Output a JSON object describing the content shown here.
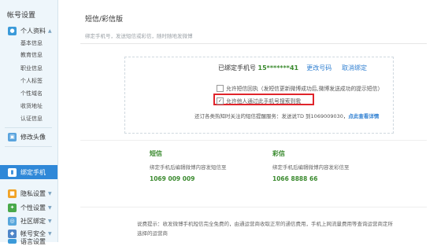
{
  "sidebar": {
    "title": "帐号设置",
    "personal": {
      "label": "个人资料",
      "items": [
        "基本信息",
        "教育信息",
        "职业信息",
        "个人标签",
        "个性域名",
        "收货地址",
        "认证信息"
      ]
    },
    "groups": [
      {
        "label": "修改头像"
      },
      {
        "label": "绑定手机"
      },
      {
        "label": "隐私设置"
      },
      {
        "label": "个性设置"
      },
      {
        "label": "社区绑定"
      },
      {
        "label": "帐号安全"
      },
      {
        "label": "语言设置"
      }
    ],
    "colors": {
      "active_bg": "#2f88d8",
      "accent": "#2f7fd1"
    }
  },
  "main": {
    "title": "短信/彩信版",
    "subtitle": "绑定手机号，发送短信或彩信，随时随地发微博",
    "binding": {
      "prefix": "已绑定手机号",
      "phone": "15*******41",
      "change_link": "更改号码",
      "unbind_link": "取消绑定"
    },
    "options": {
      "opt1": "允许短信回执（发短信更新微博成功后,微博发送成功的提示短信）",
      "opt2": "允许他人通过此手机号搜索到我"
    },
    "notice": {
      "text": "还订各类热知时关注的短信提醒服务：发送说TD 到1069009030，",
      "link": "点此查看详情"
    },
    "sms": {
      "title": "短信",
      "desc": "绑定手机后编辑微博内容发短信至",
      "number": "1069 009 009"
    },
    "mms": {
      "title": "彩信",
      "desc": "绑定手机后编辑微博内容发彩信至",
      "number": "1066 8888 66"
    },
    "footer": {
      "line1": "说费提示：收发微博手机短信完全免费的，由通运营商收取正常的通信费用，手机上网流量费用等查询运营商定所",
      "line2": "选择的运营商"
    }
  }
}
